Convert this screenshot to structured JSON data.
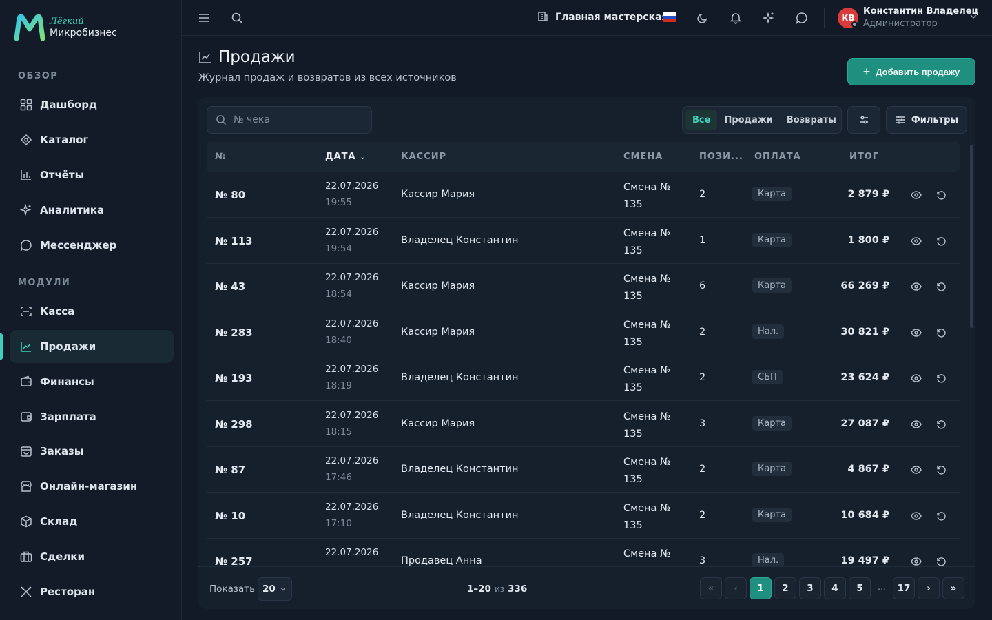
{
  "brand": {
    "top": "Лёгкий",
    "bottom": "Микробизнес"
  },
  "sidebar": {
    "sections": [
      {
        "title": "ОБЗОР",
        "items": [
          {
            "label": "Дашборд",
            "icon": "dashboard-icon"
          },
          {
            "label": "Каталог",
            "icon": "catalog-icon"
          },
          {
            "label": "Отчёты",
            "icon": "reports-icon"
          },
          {
            "label": "Аналитика",
            "icon": "sparkle-icon"
          },
          {
            "label": "Мессенджер",
            "icon": "message-icon"
          }
        ]
      },
      {
        "title": "МОДУЛИ",
        "items": [
          {
            "label": "Касса",
            "icon": "scan-icon"
          },
          {
            "label": "Продажи",
            "icon": "chart-line-icon",
            "active": true
          },
          {
            "label": "Финансы",
            "icon": "wallet-icon"
          },
          {
            "label": "Зарплата",
            "icon": "wallet-icon"
          },
          {
            "label": "Заказы",
            "icon": "bag-icon"
          },
          {
            "label": "Онлайн-магазин",
            "icon": "store-icon"
          },
          {
            "label": "Склад",
            "icon": "box-icon"
          },
          {
            "label": "Сделки",
            "icon": "briefcase-icon"
          },
          {
            "label": "Ресторан",
            "icon": "utensils-icon"
          }
        ]
      }
    ]
  },
  "header": {
    "workshop": "Главная мастерская",
    "user": {
      "initials": "КВ",
      "name": "Константин Владелец",
      "role": "Администратор"
    }
  },
  "page": {
    "title": "Продажи",
    "subtitle": "Журнал продаж и возвратов из всех источников",
    "add_button": "Добавить продажу"
  },
  "toolbar": {
    "search_placeholder": "№ чека",
    "segments": [
      "Все",
      "Продажи",
      "Возвраты"
    ],
    "active_segment": "Все",
    "filters_label": "Фильтры"
  },
  "table": {
    "columns": [
      "№",
      "ДАТА",
      "КАССИР",
      "СМЕНА",
      "ПОЗИ...",
      "ОПЛАТА",
      "ИТОГ"
    ],
    "rows": [
      {
        "num": "№ 80",
        "date": "22.07.2026",
        "time": "19:55",
        "cashier": "Кассир Мария",
        "shift": "Смена №",
        "shift_num": "135",
        "positions": "2",
        "payment": "Карта",
        "total": "2 879 ₽"
      },
      {
        "num": "№ 113",
        "date": "22.07.2026",
        "time": "19:54",
        "cashier": "Владелец Константин",
        "shift": "Смена №",
        "shift_num": "135",
        "positions": "1",
        "payment": "Карта",
        "total": "1 800 ₽"
      },
      {
        "num": "№ 43",
        "date": "22.07.2026",
        "time": "18:54",
        "cashier": "Кассир Мария",
        "shift": "Смена №",
        "shift_num": "135",
        "positions": "6",
        "payment": "Карта",
        "total": "66 269 ₽"
      },
      {
        "num": "№ 283",
        "date": "22.07.2026",
        "time": "18:40",
        "cashier": "Кассир Мария",
        "shift": "Смена №",
        "shift_num": "135",
        "positions": "2",
        "payment": "Нал.",
        "total": "30 821 ₽"
      },
      {
        "num": "№ 193",
        "date": "22.07.2026",
        "time": "18:19",
        "cashier": "Владелец Константин",
        "shift": "Смена №",
        "shift_num": "135",
        "positions": "2",
        "payment": "СБП",
        "total": "23 624 ₽"
      },
      {
        "num": "№ 298",
        "date": "22.07.2026",
        "time": "18:15",
        "cashier": "Кассир Мария",
        "shift": "Смена №",
        "shift_num": "135",
        "positions": "3",
        "payment": "Карта",
        "total": "27 087 ₽"
      },
      {
        "num": "№ 87",
        "date": "22.07.2026",
        "time": "17:46",
        "cashier": "Владелец Константин",
        "shift": "Смена №",
        "shift_num": "135",
        "positions": "2",
        "payment": "Карта",
        "total": "4 867 ₽"
      },
      {
        "num": "№ 10",
        "date": "22.07.2026",
        "time": "17:10",
        "cashier": "Владелец Константин",
        "shift": "Смена №",
        "shift_num": "135",
        "positions": "2",
        "payment": "Карта",
        "total": "10 684 ₽"
      },
      {
        "num": "№ 257",
        "date": "22.07.2026",
        "time": "",
        "cashier": "Продавец Анна",
        "shift": "Смена №",
        "shift_num": "",
        "positions": "3",
        "payment": "Нал.",
        "total": "19 497 ₽"
      }
    ]
  },
  "pagination": {
    "show_label": "Показать",
    "page_size": "20",
    "range": "1–20",
    "of": "из",
    "total": "336",
    "pages": [
      "1",
      "2",
      "3",
      "4",
      "5"
    ],
    "ellipsis": "...",
    "last_page": "17",
    "current_page": "1"
  },
  "colors": {
    "accent": "#3cd1b9",
    "primary_button": "#1f8f80",
    "background": "#111a26"
  }
}
